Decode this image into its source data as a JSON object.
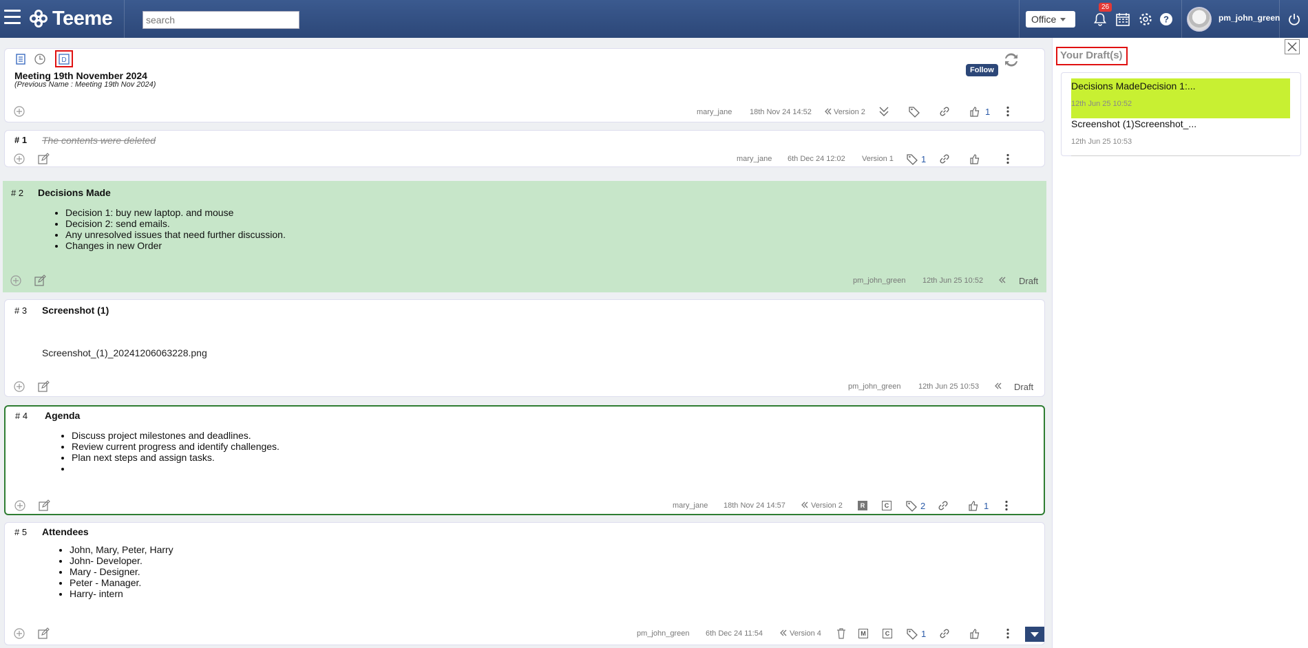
{
  "app": {
    "name": "Teeme"
  },
  "search": {
    "placeholder": "search"
  },
  "workspace": {
    "selected": "Office"
  },
  "notifications": {
    "count": "26"
  },
  "user": {
    "name": "pm_john_green"
  },
  "document": {
    "title": "Meeting 19th November 2024",
    "previous_name": "(Previous Name   : Meeting 19th Nov 2024)",
    "follow_label": "Follow",
    "meta": {
      "author": "mary_jane",
      "date": "18th Nov 24 14:52",
      "version": "Version 2",
      "like_count": "1"
    }
  },
  "sections": [
    {
      "num": "# 1",
      "deleted_text": "The contents were deleted",
      "author": "mary_jane",
      "date": "6th Dec 24 12:02",
      "version": "Version 1",
      "tag_count": "1"
    },
    {
      "num": "# 2",
      "title": "Decisions Made",
      "items": [
        "Decision 1: buy new laptop. and mouse",
        "Decision 2: send emails.",
        "Any unresolved issues that need further discussion.",
        "Changes in new Order"
      ],
      "author": "pm_john_green",
      "date": "12th Jun 25 10:52",
      "status": "Draft"
    },
    {
      "num": "# 3",
      "title": "Screenshot (1)",
      "file": "Screenshot_(1)_20241206063228.png",
      "author": "pm_john_green",
      "date": "12th Jun 25 10:53",
      "status": "Draft"
    },
    {
      "num": "# 4",
      "title": "Agenda",
      "items": [
        "Discuss project milestones and deadlines.",
        "Review current progress and identify challenges.",
        "Plan next steps and assign tasks.",
        ""
      ],
      "author": "mary_jane",
      "date": "18th Nov 24 14:57",
      "version": "Version 2",
      "badge_r": "R",
      "badge_c": "C",
      "tag_count": "2",
      "like_count": "1"
    },
    {
      "num": "# 5",
      "title": "Attendees",
      "items": [
        "John, Mary, Peter, Harry",
        "John- Developer.",
        "Mary - Designer.",
        "Peter - Manager.",
        "Harry- intern"
      ],
      "author": "pm_john_green",
      "date": "6th Dec 24 11:54",
      "version": "Version 4",
      "badge_m": "M",
      "badge_c": "C",
      "tag_count": "1"
    }
  ],
  "drafts_panel": {
    "title": "Your Draft(s)",
    "items": [
      {
        "title": "Decisions MadeDecision 1:...",
        "time": "12th Jun 25 10:52"
      },
      {
        "title": "Screenshot (1)Screenshot_...",
        "time": "12th Jun 25 10:53"
      }
    ]
  },
  "colors": {
    "topbar": "#2c4778",
    "draft_section": "#c7e6c9",
    "highlight": "#c8f032",
    "active_border": "#2e7d32",
    "annotation": "#e01010"
  }
}
